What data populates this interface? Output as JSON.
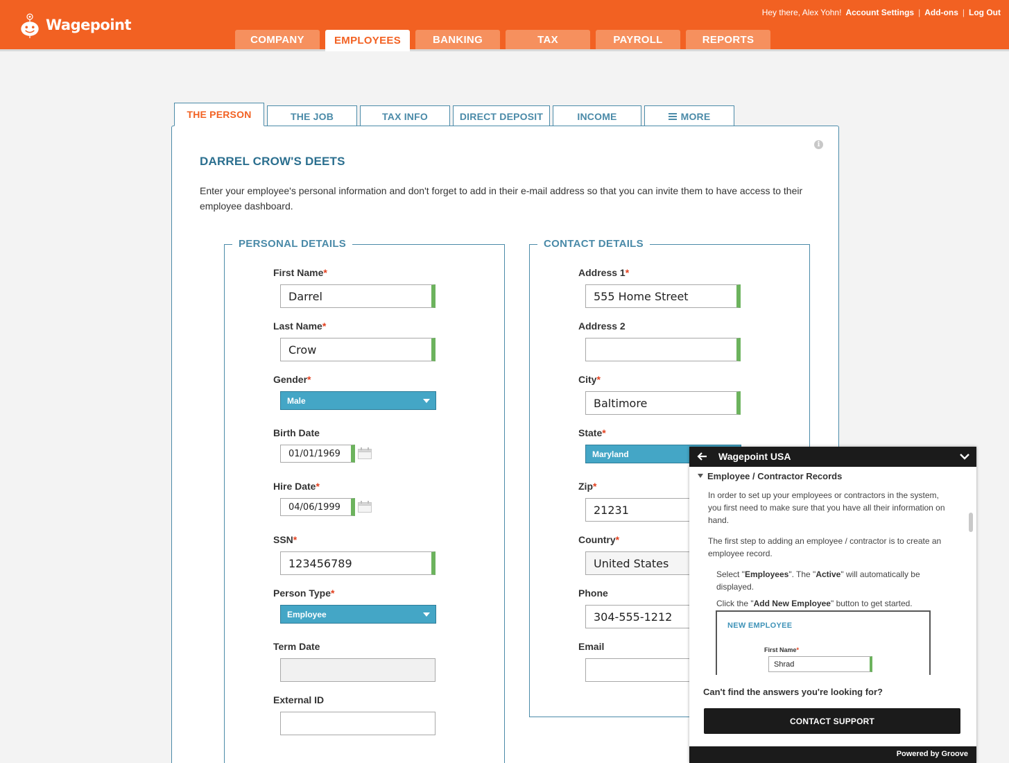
{
  "header": {
    "logo_text": "Wagepoint",
    "greeting": "Hey there, Alex Yohn!",
    "links": [
      "Account Settings",
      "Add-ons",
      "Log Out"
    ],
    "brand_color": "#f26122"
  },
  "main_nav": [
    {
      "label": "COMPANY",
      "active": false
    },
    {
      "label": "EMPLOYEES",
      "active": true
    },
    {
      "label": "BANKING",
      "active": false
    },
    {
      "label": "TAX",
      "active": false
    },
    {
      "label": "PAYROLL",
      "active": false
    },
    {
      "label": "REPORTS",
      "active": false
    }
  ],
  "sub_tabs": [
    {
      "label": "THE PERSON",
      "active": true
    },
    {
      "label": "THE JOB",
      "active": false
    },
    {
      "label": "TAX INFO",
      "active": false
    },
    {
      "label": "DIRECT DEPOSIT",
      "active": false
    },
    {
      "label": "INCOME",
      "active": false
    },
    {
      "label": "MORE",
      "active": false,
      "icon": "menu-icon"
    }
  ],
  "page": {
    "title": "DARREL CROW'S DEETS",
    "intro": "Enter your employee's personal information and don't forget to add in their e-mail address so that you can invite them to have access to their employee dashboard."
  },
  "personal": {
    "legend": "PERSONAL DETAILS",
    "first_name_label": "First Name",
    "first_name": "Darrel",
    "last_name_label": "Last Name",
    "last_name": "Crow",
    "gender_label": "Gender",
    "gender": "Male",
    "birth_date_label": "Birth Date",
    "birth_date": "01/01/1969",
    "hire_date_label": "Hire Date",
    "hire_date": "04/06/1999",
    "ssn_label": "SSN",
    "ssn": "123456789",
    "person_type_label": "Person Type",
    "person_type": "Employee",
    "term_date_label": "Term Date",
    "term_date": "",
    "external_id_label": "External ID",
    "external_id": ""
  },
  "contact": {
    "legend": "CONTACT DETAILS",
    "address1_label": "Address 1",
    "address1": "555 Home Street",
    "address2_label": "Address 2",
    "address2": "",
    "city_label": "City",
    "city": "Baltimore",
    "state_label": "State",
    "state": "Maryland",
    "zip_label": "Zip",
    "zip": "21231",
    "country_label": "Country",
    "country": "United States",
    "phone_label": "Phone",
    "phone": "304-555-1212",
    "email_label": "Email",
    "email": ""
  },
  "widget": {
    "title": "Wagepoint USA",
    "section": "Employee / Contractor Records",
    "p1": "In order to set up your employees or contractors in the system, you first need to make sure that you have all their information on hand.",
    "p2": "The first step to adding an employee / contractor is to create an employee record.",
    "p3_pre": "Select \"",
    "p3_b1": "Employees",
    "p3_mid": "\". The \"",
    "p3_b2": "Active",
    "p3_post": "\" will automatically be displayed.",
    "p4_pre": "Click the \"",
    "p4_b": "Add New Employee",
    "p4_post": "\" button to get started.",
    "shot_title": "NEW EMPLOYEE",
    "shot_label": "First Name",
    "shot_value": "Shrad",
    "question": "Can't find the answers you're looking for?",
    "button": "CONTACT SUPPORT",
    "powered": "Powered by Groove"
  }
}
